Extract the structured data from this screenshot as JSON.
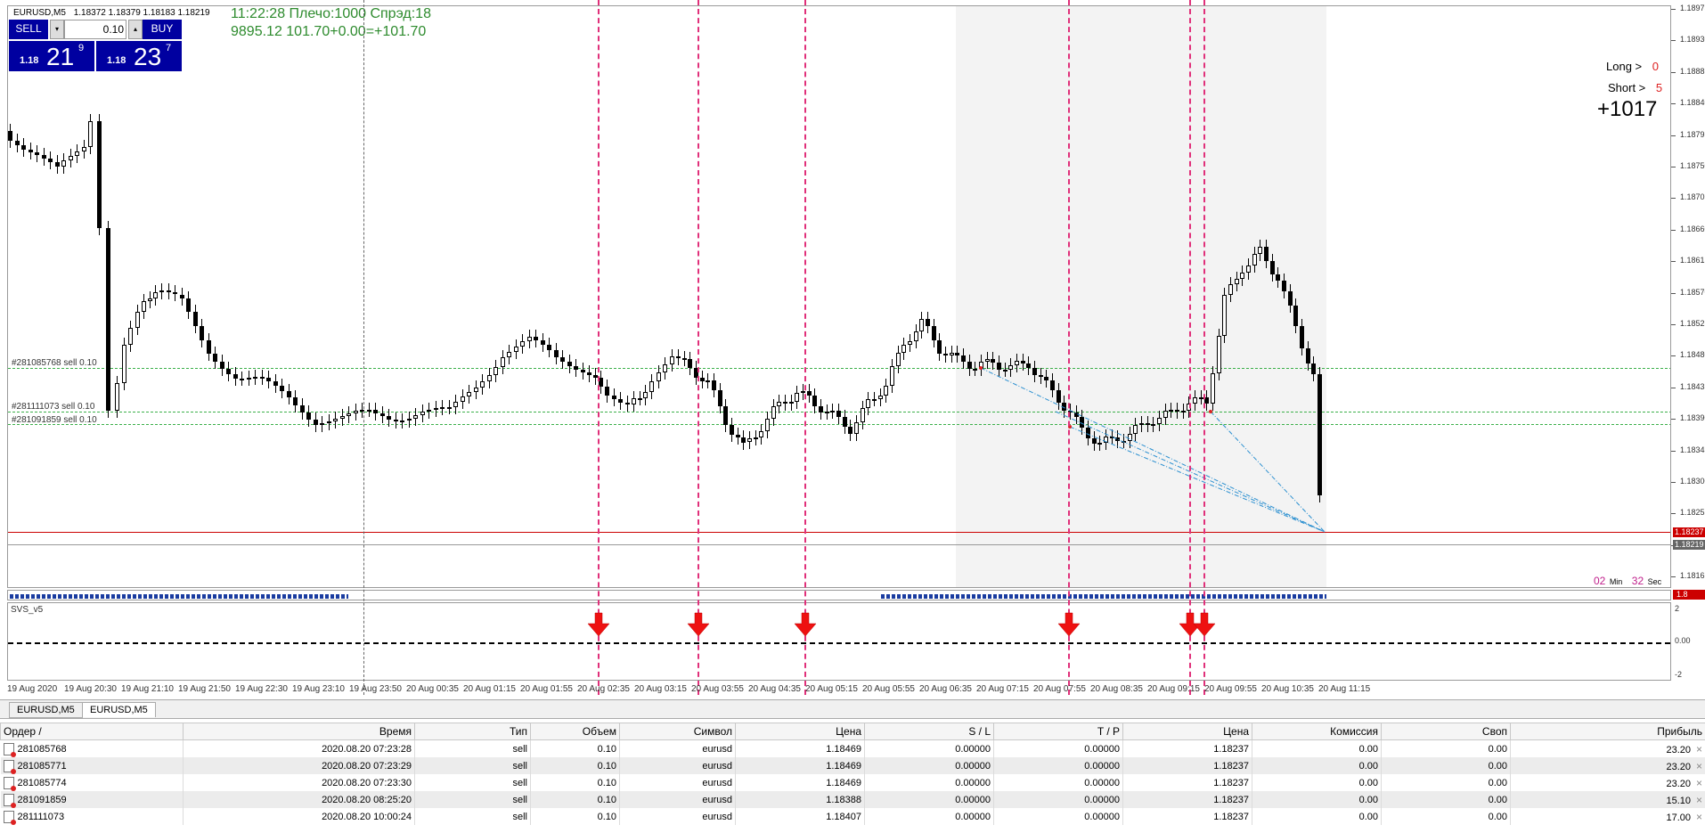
{
  "symbol_header": {
    "title": "EURUSD,M5",
    "ohlc": "1.18372 1.18379 1.18183 1.18219"
  },
  "trade_panel": {
    "sell_label": "SELL",
    "buy_label": "BUY",
    "lot": "0.10",
    "sell_prefix": "1.18",
    "sell_big": "21",
    "sell_sup": "9",
    "buy_prefix": "1.18",
    "buy_big": "23",
    "buy_sup": "7"
  },
  "info": {
    "line1": "11:22:28 Плечо:1000 Спрэд:18",
    "line2": "9895.12   101.70+0.00=+101.70"
  },
  "stats": {
    "long_label": "Long >",
    "long_value": "0",
    "short_label": "Short >",
    "short_value": "5",
    "total": "+1017"
  },
  "timer": {
    "min": "02",
    "min_label": "Min",
    "sec": "32",
    "sec_label": "Sec"
  },
  "order_lines": [
    {
      "label": "#281085768 sell 0.10"
    },
    {
      "label": "#281111073 sell 0.10"
    },
    {
      "label": "#281091859 sell 0.10"
    }
  ],
  "indicator": {
    "name": "SVS_v5",
    "levels": [
      "2",
      "0.00",
      "-2"
    ],
    "current_tag": "1.8"
  },
  "y_axis": [
    "1.18975",
    "1.18930",
    "1.18885",
    "1.18840",
    "1.18795",
    "1.18750",
    "1.18705",
    "1.18660",
    "1.18615",
    "1.18570",
    "1.18525",
    "1.18480",
    "1.18435",
    "1.18390",
    "1.18345",
    "1.18300",
    "1.18255",
    "1.18210",
    "1.18165"
  ],
  "price_tags": {
    "red": "1.18237",
    "grey": "1.18219"
  },
  "x_axis": [
    "19 Aug 2020",
    "19 Aug 20:30",
    "19 Aug 21:10",
    "19 Aug 21:50",
    "19 Aug 22:30",
    "19 Aug 23:10",
    "19 Aug 23:50",
    "20 Aug 00:35",
    "20 Aug 01:15",
    "20 Aug 01:55",
    "20 Aug 02:35",
    "20 Aug 03:15",
    "20 Aug 03:55",
    "20 Aug 04:35",
    "20 Aug 05:15",
    "20 Aug 05:55",
    "20 Aug 06:35",
    "20 Aug 07:15",
    "20 Aug 07:55",
    "20 Aug 08:35",
    "20 Aug 09:15",
    "20 Aug 09:55",
    "20 Aug 10:35",
    "20 Aug 11:15"
  ],
  "tabs": [
    "EURUSD,M5",
    "EURUSD,M5"
  ],
  "table": {
    "headers": [
      "Ордер  /",
      "Время",
      "Тип",
      "Объем",
      "Символ",
      "Цена",
      "S / L",
      "T / P",
      "Цена",
      "Комиссия",
      "Своп",
      "Прибыль"
    ],
    "rows": [
      [
        "281085768",
        "2020.08.20 07:23:28",
        "sell",
        "0.10",
        "eurusd",
        "1.18469",
        "0.00000",
        "0.00000",
        "1.18237",
        "0.00",
        "0.00",
        "23.20"
      ],
      [
        "281085771",
        "2020.08.20 07:23:29",
        "sell",
        "0.10",
        "eurusd",
        "1.18469",
        "0.00000",
        "0.00000",
        "1.18237",
        "0.00",
        "0.00",
        "23.20"
      ],
      [
        "281085774",
        "2020.08.20 07:23:30",
        "sell",
        "0.10",
        "eurusd",
        "1.18469",
        "0.00000",
        "0.00000",
        "1.18237",
        "0.00",
        "0.00",
        "23.20"
      ],
      [
        "281091859",
        "2020.08.20 08:25:20",
        "sell",
        "0.10",
        "eurusd",
        "1.18388",
        "0.00000",
        "0.00000",
        "1.18237",
        "0.00",
        "0.00",
        "15.10"
      ],
      [
        "281111073",
        "2020.08.20 10:00:24",
        "sell",
        "0.10",
        "eurusd",
        "1.18407",
        "0.00000",
        "0.00000",
        "1.18237",
        "0.00",
        "0.00",
        "17.00"
      ]
    ]
  },
  "colors": {
    "panel_blue": "#0000a0",
    "sell_vline": "#e0307a",
    "order_line": "#3cb04a",
    "bid_line": "#cc0000",
    "info_green": "#2e8b2e",
    "arrow_red": "#ee1111"
  }
}
